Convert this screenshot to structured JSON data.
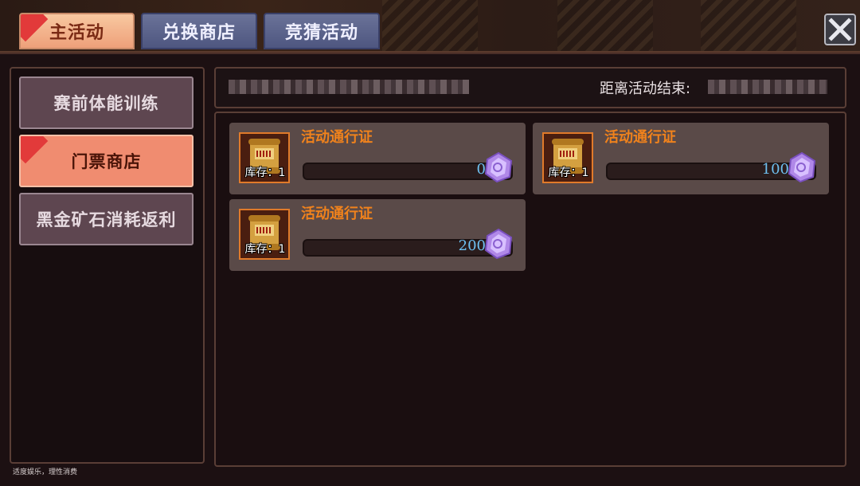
{
  "tabs": [
    {
      "label": "主活动",
      "active": true
    },
    {
      "label": "兑换商店",
      "active": false
    },
    {
      "label": "竞猜活动",
      "active": false
    }
  ],
  "sidebar": {
    "items": [
      {
        "label": "赛前体能训练",
        "active": false
      },
      {
        "label": "门票商店",
        "active": true
      },
      {
        "label": "黑金矿石消耗返利",
        "active": false
      }
    ]
  },
  "header": {
    "end_label": "距离活动结束:"
  },
  "shop": {
    "items": [
      {
        "name": "活动通行证",
        "stock": "库存：1",
        "price": "0",
        "icon": "scroll-icon",
        "currency_icon": "purple-gem-icon"
      },
      {
        "name": "活动通行证",
        "stock": "库存：1",
        "price": "100",
        "icon": "scroll-icon",
        "currency_icon": "purple-gem-icon"
      },
      {
        "name": "活动通行证",
        "stock": "库存：1",
        "price": "200",
        "icon": "scroll-icon",
        "currency_icon": "purple-gem-icon"
      }
    ]
  },
  "footer": {
    "note": "适度娱乐，理性消费"
  },
  "colors": {
    "accent": "#f08c70",
    "title_orange": "#f0821c",
    "price_blue": "#6ec0f0"
  }
}
